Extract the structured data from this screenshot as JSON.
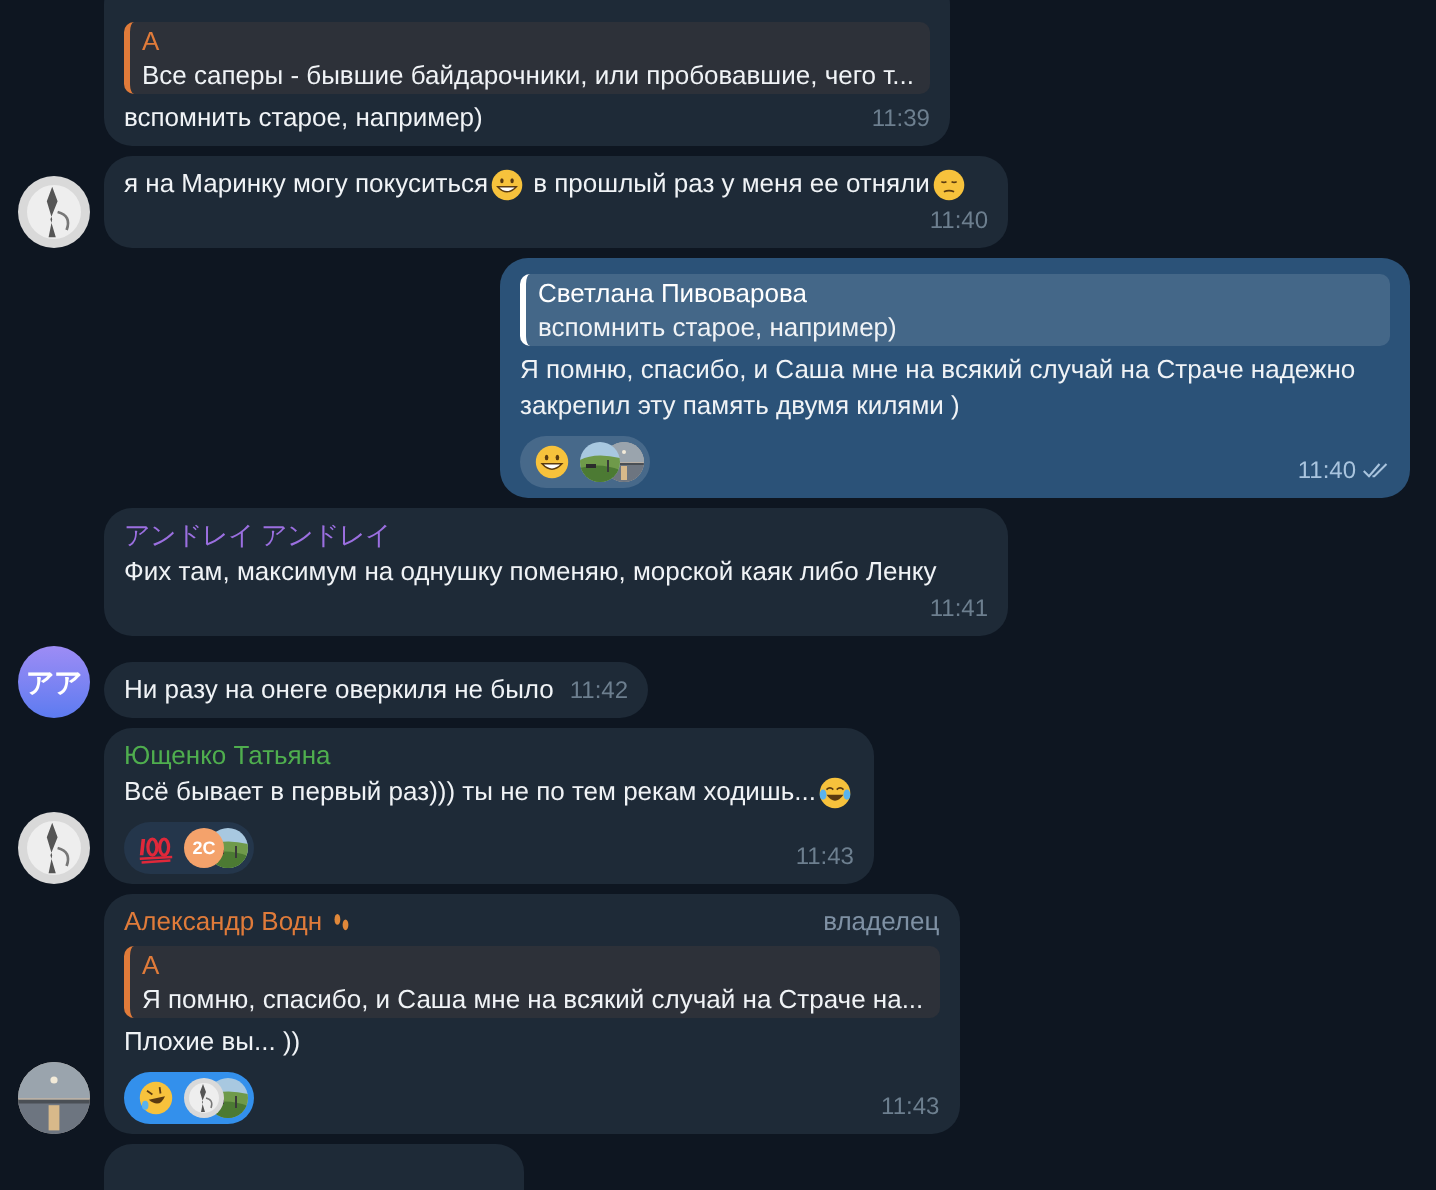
{
  "messages": [
    {
      "kind": "incoming",
      "reply": {
        "author": "А",
        "text": "Все саперы - бывшие байдарочники, или пробовавшие, чего т..."
      },
      "parts": [
        {
          "kind": "text",
          "text": "вспомнить старое, например)"
        }
      ],
      "time": "11:39"
    },
    {
      "kind": "incoming",
      "avatar": {
        "kind": "picture"
      },
      "parts": [
        {
          "kind": "text",
          "text": "я на Маринку могу покуситься"
        },
        {
          "kind": "grin"
        },
        {
          "kind": "text",
          "text": " в прошлый раз у меня ее отняли"
        },
        {
          "kind": "sad"
        }
      ],
      "time": "11:40"
    },
    {
      "kind": "outgoing",
      "reply": {
        "author": "Светлана Пивоварова",
        "text": "вспомнить старое, например)"
      },
      "parts": [
        {
          "kind": "text",
          "text": "Я помню, спасибо, и Саша мне на всякий случай на Страче надежно закрепил эту память двумя килями )"
        }
      ],
      "reactions": [
        {
          "kind": "grin",
          "selected": false,
          "users": [
            {
              "kind": "picture"
            },
            {
              "kind": "picture"
            }
          ]
        }
      ],
      "time": "11:40",
      "read": true
    },
    {
      "kind": "incoming",
      "sender": "アンドレイ アンドレイ",
      "color": "#9b6fe0",
      "parts": [
        {
          "kind": "text",
          "text": "Фих там, максимум на однушку поменяю, морской каяк либо Ленку"
        }
      ],
      "time": "11:41"
    },
    {
      "kind": "incoming",
      "avatar": {
        "kind": "initials",
        "text": "アア"
      },
      "parts": [
        {
          "kind": "text",
          "text": "Ни разу на онеге оверкиля не было"
        }
      ],
      "time": "11:42"
    },
    {
      "kind": "incoming",
      "sender": "Ющенко Татьяна",
      "color": "#4fae4e",
      "avatar": {
        "kind": "picture"
      },
      "parts": [
        {
          "kind": "text",
          "text": "Всё бывает в первый раз))) ты не по тем рекам ходишь..."
        },
        {
          "kind": "joy"
        }
      ],
      "reactions": [
        {
          "kind": "hundred",
          "selected": false,
          "users": [
            {
              "kind": "initials",
              "text": "2C"
            },
            {
              "kind": "picture"
            }
          ]
        }
      ],
      "time": "11:43"
    },
    {
      "kind": "incoming",
      "sender": "Александр Водн",
      "color": "#e07b3a",
      "sender_badge": true,
      "role": "владелец",
      "avatar": {
        "kind": "picture"
      },
      "reply": {
        "author": "А",
        "text": "Я помню, спасибо, и Саша мне на всякий случай на Страче на..."
      },
      "parts": [
        {
          "kind": "text",
          "text": "Плохие вы... ))"
        }
      ],
      "reactions": [
        {
          "kind": "rofl",
          "selected": true,
          "users": [
            {
              "kind": "picture"
            },
            {
              "kind": "picture"
            }
          ]
        }
      ],
      "time": "11:43"
    },
    {
      "kind": "incoming"
    }
  ]
}
